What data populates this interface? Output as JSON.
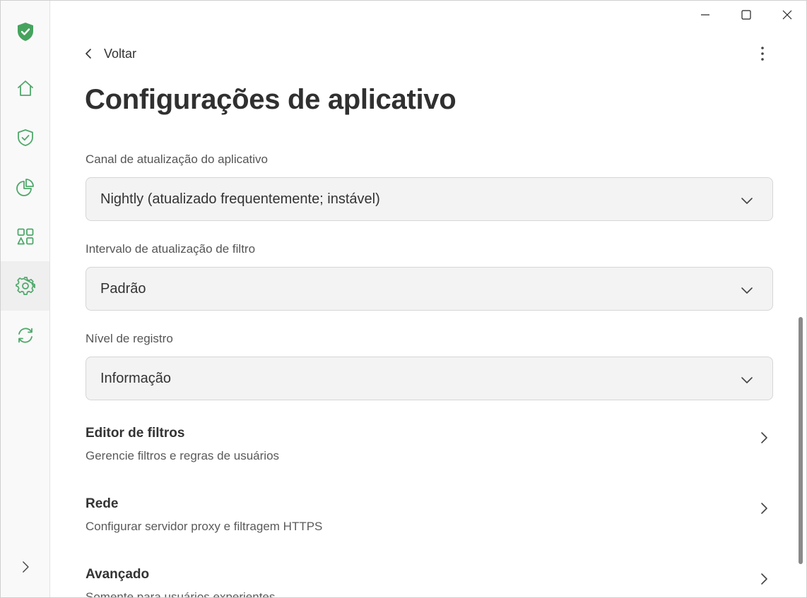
{
  "window": {
    "controls": [
      "minimize",
      "maximize",
      "close"
    ]
  },
  "sidebar": {
    "items": [
      {
        "name": "protection-logo",
        "icon": "shield-check-filled-icon"
      },
      {
        "name": "home",
        "icon": "home-icon"
      },
      {
        "name": "protection",
        "icon": "shield-check-icon"
      },
      {
        "name": "statistics",
        "icon": "pie-chart-icon"
      },
      {
        "name": "apps",
        "icon": "apps-icon"
      },
      {
        "name": "settings",
        "icon": "gear-icon",
        "active": true
      },
      {
        "name": "updates",
        "icon": "sync-icon"
      }
    ],
    "expand_icon": "chevron-right-icon"
  },
  "header": {
    "back_label": "Voltar",
    "title": "Configurações de aplicativo"
  },
  "fields": {
    "update_channel": {
      "label": "Canal de atualização do aplicativo",
      "value": "Nightly (atualizado frequentemente; instável)"
    },
    "filter_interval": {
      "label": "Intervalo de atualização de filtro",
      "value": "Padrão"
    },
    "log_level": {
      "label": "Nível de registro",
      "value": "Informação"
    }
  },
  "links": {
    "filter_editor": {
      "title": "Editor de filtros",
      "subtitle": "Gerencie filtros e regras de usuários"
    },
    "network": {
      "title": "Rede",
      "subtitle": "Configurar servidor proxy e filtragem HTTPS"
    },
    "advanced": {
      "title": "Avançado",
      "subtitle": "Somente para usuários experientes"
    }
  },
  "colors": {
    "accent": "#4fa86a",
    "logo": "#46a35e",
    "sidebar_bg": "#f9f9f9",
    "select_bg": "#f3f3f3"
  }
}
